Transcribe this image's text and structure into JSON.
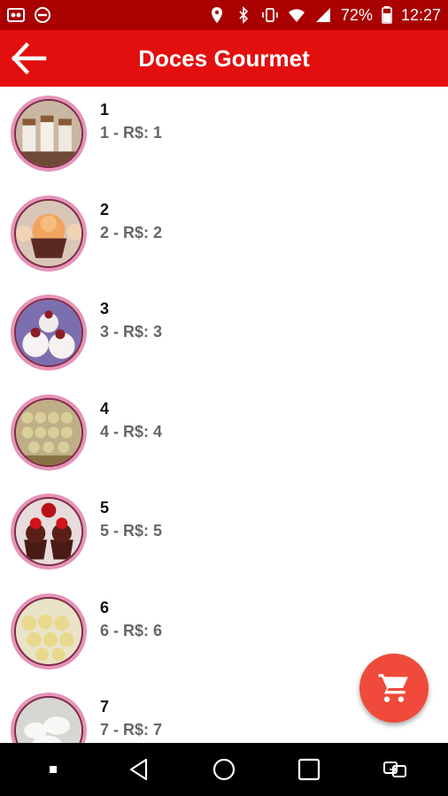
{
  "status_bar": {
    "battery": "72%",
    "time": "12:27",
    "icons": [
      "voicemail-icon",
      "no-entry-icon",
      "location-icon",
      "bluetooth-icon",
      "vibrate-icon",
      "wifi-icon",
      "signal-icon",
      "battery-icon"
    ]
  },
  "app_bar": {
    "title": "Doces Gourmet",
    "back_icon": "arrow-left-icon"
  },
  "colors": {
    "status_bar": "#a90000",
    "app_bar": "#e30f0f",
    "fab": "#ef4a3a",
    "thumb_ring": "#e693b8"
  },
  "products": [
    {
      "title": "1",
      "subtitle": "1 - R$: 1"
    },
    {
      "title": "2",
      "subtitle": "2 - R$: 2"
    },
    {
      "title": "3",
      "subtitle": "3 - R$: 3"
    },
    {
      "title": "4",
      "subtitle": "4 - R$: 4"
    },
    {
      "title": "5",
      "subtitle": "5 - R$: 5"
    },
    {
      "title": "6",
      "subtitle": "6 - R$: 6"
    },
    {
      "title": "7",
      "subtitle": "7 - R$: 7"
    }
  ],
  "fab": {
    "icon": "shopping-cart-icon"
  },
  "nav_bar": {
    "icons": [
      "dot-icon",
      "back-triangle-icon",
      "home-circle-icon",
      "recents-square-icon",
      "switch-app-icon"
    ]
  }
}
